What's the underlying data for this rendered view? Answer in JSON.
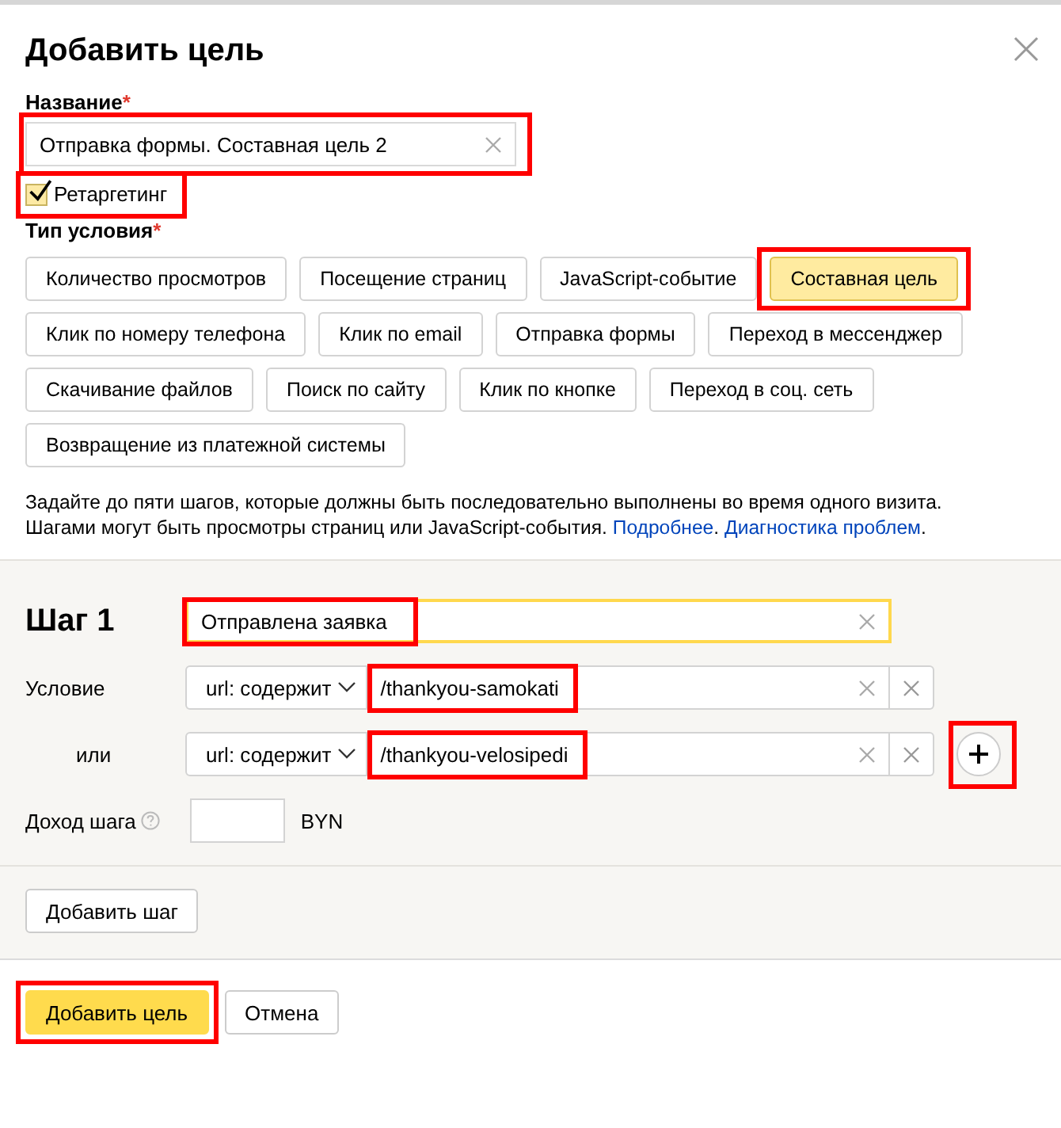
{
  "dialog": {
    "title": "Добавить цель"
  },
  "name_field": {
    "label": "Название",
    "required_mark": "*",
    "value": "Отправка формы. Составная цель 2",
    "highlighted": true
  },
  "retargeting": {
    "label": "Ретаргетинг",
    "checked": true,
    "highlighted": true
  },
  "condition_type": {
    "label": "Тип условия",
    "required_mark": "*",
    "options": [
      {
        "label": "Количество просмотров",
        "selected": false,
        "highlighted": false
      },
      {
        "label": "Посещение страниц",
        "selected": false,
        "highlighted": false
      },
      {
        "label": "JavaScript-событие",
        "selected": false,
        "highlighted": false
      },
      {
        "label": "Составная цель",
        "selected": true,
        "highlighted": true
      },
      {
        "label": "Клик по номеру телефона",
        "selected": false,
        "highlighted": false
      },
      {
        "label": "Клик по email",
        "selected": false,
        "highlighted": false
      },
      {
        "label": "Отправка формы",
        "selected": false,
        "highlighted": false
      },
      {
        "label": "Переход в мессенджер",
        "selected": false,
        "highlighted": false
      },
      {
        "label": "Скачивание файлов",
        "selected": false,
        "highlighted": false
      },
      {
        "label": "Поиск по сайту",
        "selected": false,
        "highlighted": false
      },
      {
        "label": "Клик по кнопке",
        "selected": false,
        "highlighted": false
      },
      {
        "label": "Переход в соц. сеть",
        "selected": false,
        "highlighted": false
      },
      {
        "label": "Возвращение из платежной системы",
        "selected": false,
        "highlighted": false
      }
    ]
  },
  "hint": {
    "text": "Задайте до пяти шагов, которые должны быть последовательно выполнены во время одного визита. Шагами могут быть просмотры страниц или JavaScript-события.",
    "links": [
      {
        "label": "Подробнее",
        "suffix": "."
      },
      {
        "label": "Диагностика проблем",
        "suffix": "."
      }
    ]
  },
  "step": {
    "title": "Шаг 1",
    "name": "Отправлена заявка",
    "name_highlighted": true,
    "conditions": [
      {
        "label": "Условие",
        "operator": "url: содержит",
        "value": "/thankyou-samokati",
        "highlighted": true
      },
      {
        "label": "или",
        "operator": "url: содержит",
        "value": "/thankyou-velosipedi",
        "highlighted": true
      }
    ],
    "add_condition_highlighted": true,
    "income": {
      "label": "Доход шага",
      "currency": "BYN"
    }
  },
  "add_step_button": "Добавить шаг",
  "footer": {
    "buttons": [
      {
        "label": "Добавить цель",
        "kind": "primary",
        "highlighted": true
      },
      {
        "label": "Отмена",
        "kind": "secondary",
        "highlighted": false
      }
    ]
  }
}
